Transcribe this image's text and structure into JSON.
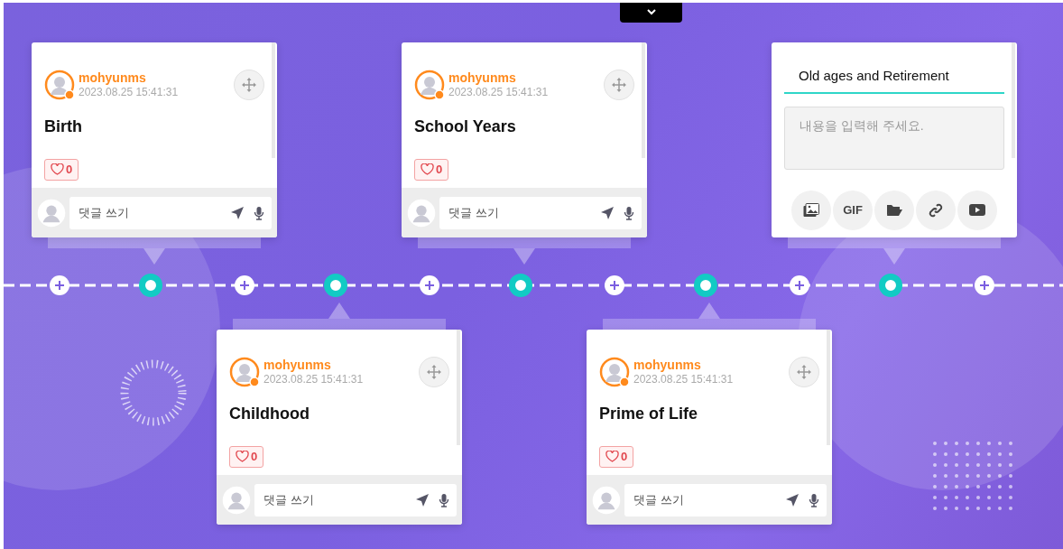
{
  "posts": [
    {
      "author": "mohyunms",
      "date": "2023.08.25 15:41:31",
      "title": "Birth",
      "likes": "0",
      "liked": false,
      "comment_placeholder": "댓글 쓰기"
    },
    {
      "author": "mohyunms",
      "date": "2023.08.25 15:41:31",
      "title": "Childhood",
      "likes": "0",
      "liked": false,
      "comment_placeholder": "댓글 쓰기"
    },
    {
      "author": "mohyunms",
      "date": "2023.08.25 15:41:31",
      "title": "School Years",
      "likes": "0",
      "liked": false,
      "comment_placeholder": "댓글 쓰기"
    },
    {
      "author": "mohyunms",
      "date": "2023.08.25 15:41:31",
      "title": "Prime of Life",
      "likes": "0",
      "liked": false,
      "comment_placeholder": "댓글 쓰기"
    }
  ],
  "editor": {
    "title_value": "Old ages and Retirement",
    "body_placeholder": "내용을 입력해 주세요.",
    "tools": [
      {
        "kind": "image"
      },
      {
        "kind": "gif",
        "label": "GIF"
      },
      {
        "kind": "folder"
      },
      {
        "kind": "link"
      },
      {
        "kind": "video"
      }
    ]
  }
}
